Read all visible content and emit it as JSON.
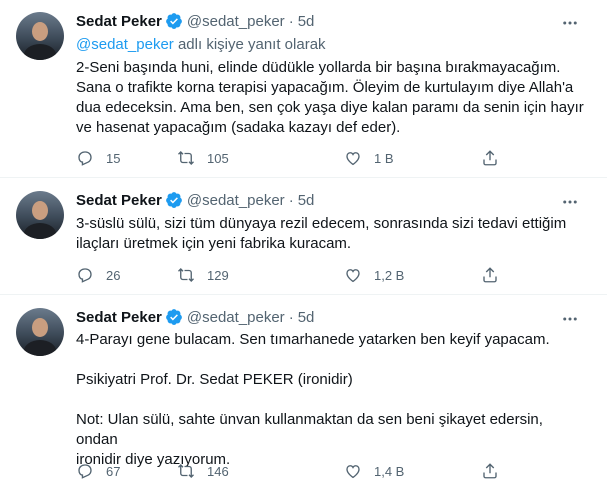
{
  "colors": {
    "accent": "#1d9bf0",
    "muted": "#536471",
    "text": "#0f1419",
    "divider": "#eff3f4"
  },
  "icons": {
    "verified": "verified-badge-icon",
    "more": "more-options-icon",
    "reply": "reply-icon",
    "retweet": "retweet-icon",
    "like": "heart-icon",
    "share": "share-icon"
  },
  "tweets": [
    {
      "author_name": "Sedat Peker",
      "handle": "@sedat_peker",
      "dot": "·",
      "time": "5d",
      "reply_mention": "@sedat_peker",
      "reply_suffix": " adlı kişiye yanıt olarak",
      "lines": [
        "2-Seni başında huni, elinde düdükle yollarda bir başına bırakmayacağım.",
        "Sana o trafikte korna terapisi yapacağım. Öleyim de kurtulayım diye Allah'a",
        "dua edeceksin. Ama ben, sen çok yaşa diye kalan paramı da senin için hayır",
        "ve hasenat yapacağım (sadaka kazayı def eder)."
      ],
      "replies": "15",
      "retweets": "105",
      "likes": "1 B"
    },
    {
      "author_name": "Sedat Peker",
      "handle": "@sedat_peker",
      "dot": "·",
      "time": "5d",
      "lines": [
        "3-süslü sülü, sizi tüm dünyaya rezil edecem, sonrasında sizi tedavi ettiğim",
        "ilaçları üretmek için yeni fabrika kuracam."
      ],
      "replies": "26",
      "retweets": "129",
      "likes": "1,2 B"
    },
    {
      "author_name": "Sedat Peker",
      "handle": "@sedat_peker",
      "dot": "·",
      "time": "5d",
      "lines": [
        "4-Parayı gene bulacam. Sen tımarhanede yatarken ben keyif yapacam.",
        "",
        "Psikiyatri Prof. Dr. Sedat PEKER (ironidir)",
        "",
        "Not: Ulan sülü, sahte ünvan kullanmaktan da sen beni şikayet edersin, ondan",
        "ironidir diye yazıyorum."
      ],
      "replies": "67",
      "retweets": "146",
      "likes": "1,4 B"
    }
  ]
}
